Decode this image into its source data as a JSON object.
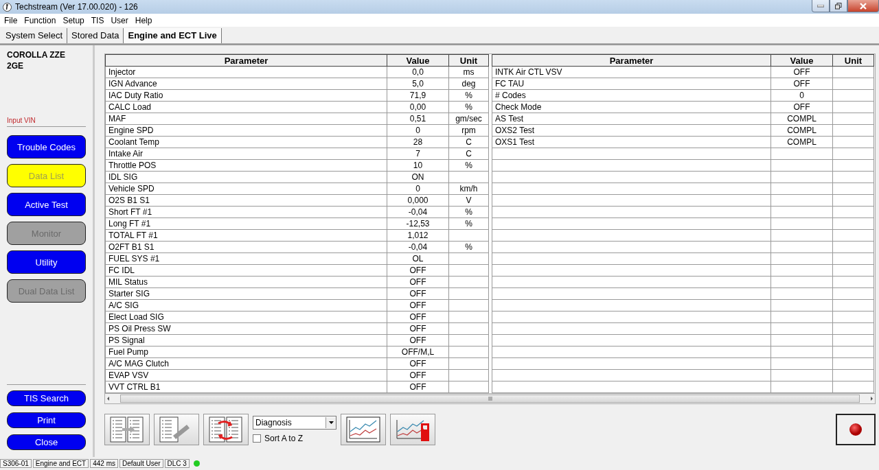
{
  "window": {
    "title": "Techstream (Ver 17.00.020) - 126"
  },
  "menu": [
    "File",
    "Function",
    "Setup",
    "TIS",
    "User",
    "Help"
  ],
  "tabs": [
    {
      "label": "System Select",
      "selected": false
    },
    {
      "label": "Stored Data",
      "selected": false
    },
    {
      "label": "Engine and ECT Live",
      "selected": true
    }
  ],
  "sidebar": {
    "vehicle": "COROLLA ZZE 2GE",
    "vin_link": "Input VIN",
    "buttons": [
      {
        "label": "Trouble Codes",
        "selected": false,
        "disabled": false
      },
      {
        "label": "Data List",
        "selected": true,
        "disabled": false
      },
      {
        "label": "Active Test",
        "selected": false,
        "disabled": false
      },
      {
        "label": "Monitor",
        "selected": false,
        "disabled": true
      },
      {
        "label": "Utility",
        "selected": false,
        "disabled": false
      },
      {
        "label": "Dual Data List",
        "selected": false,
        "disabled": true
      }
    ],
    "bottom_buttons": [
      "TIS Search",
      "Print",
      "Close"
    ]
  },
  "tables": [
    {
      "columns": [
        "Parameter",
        "Value",
        "Unit"
      ],
      "rows": [
        [
          "Injector",
          "0,0",
          "ms"
        ],
        [
          "IGN Advance",
          "5,0",
          "deg"
        ],
        [
          "IAC Duty Ratio",
          "71,9",
          "%"
        ],
        [
          "CALC Load",
          "0,00",
          "%"
        ],
        [
          "MAF",
          "0,51",
          "gm/sec"
        ],
        [
          "Engine SPD",
          "0",
          "rpm"
        ],
        [
          "Coolant Temp",
          "28",
          "C"
        ],
        [
          "Intake Air",
          "7",
          "C"
        ],
        [
          "Throttle POS",
          "10",
          "%"
        ],
        [
          "IDL SIG",
          "ON",
          ""
        ],
        [
          "Vehicle SPD",
          "0",
          "km/h"
        ],
        [
          "O2S B1 S1",
          "0,000",
          "V"
        ],
        [
          "Short FT #1",
          "-0,04",
          "%"
        ],
        [
          "Long FT #1",
          "-12,53",
          "%"
        ],
        [
          "TOTAL FT #1",
          "1,012",
          ""
        ],
        [
          "O2FT B1 S1",
          "-0,04",
          "%"
        ],
        [
          "FUEL SYS #1",
          "OL",
          ""
        ],
        [
          "FC IDL",
          "OFF",
          ""
        ],
        [
          "MIL Status",
          "OFF",
          ""
        ],
        [
          "Starter SIG",
          "OFF",
          ""
        ],
        [
          "A/C SIG",
          "OFF",
          ""
        ],
        [
          "Elect Load SIG",
          "OFF",
          ""
        ],
        [
          "PS Oil Press SW",
          "OFF",
          ""
        ],
        [
          "PS Signal",
          "OFF",
          ""
        ],
        [
          "Fuel Pump",
          "OFF/M,L",
          ""
        ],
        [
          "A/C MAG Clutch",
          "OFF",
          ""
        ],
        [
          "EVAP VSV",
          "OFF",
          ""
        ],
        [
          "VVT CTRL B1",
          "OFF",
          ""
        ]
      ]
    },
    {
      "columns": [
        "Parameter",
        "Value",
        "Unit"
      ],
      "rows": [
        [
          "INTK Air CTL VSV",
          "OFF",
          ""
        ],
        [
          "FC TAU",
          "OFF",
          ""
        ],
        [
          "# Codes",
          "0",
          ""
        ],
        [
          "Check Mode",
          "OFF",
          ""
        ],
        [
          "AS Test",
          "COMPL",
          ""
        ],
        [
          "OXS2 Test",
          "COMPL",
          ""
        ],
        [
          "OXS1 Test",
          "COMPL",
          ""
        ]
      ]
    }
  ],
  "toolbar": {
    "dropdown": "Diagnosis",
    "sort_checkbox": {
      "label": "Sort A to Z",
      "checked": false
    }
  },
  "status_bar": [
    "S306-01",
    "Engine and ECT",
    "442 ms",
    "Default User",
    "DLC 3"
  ]
}
